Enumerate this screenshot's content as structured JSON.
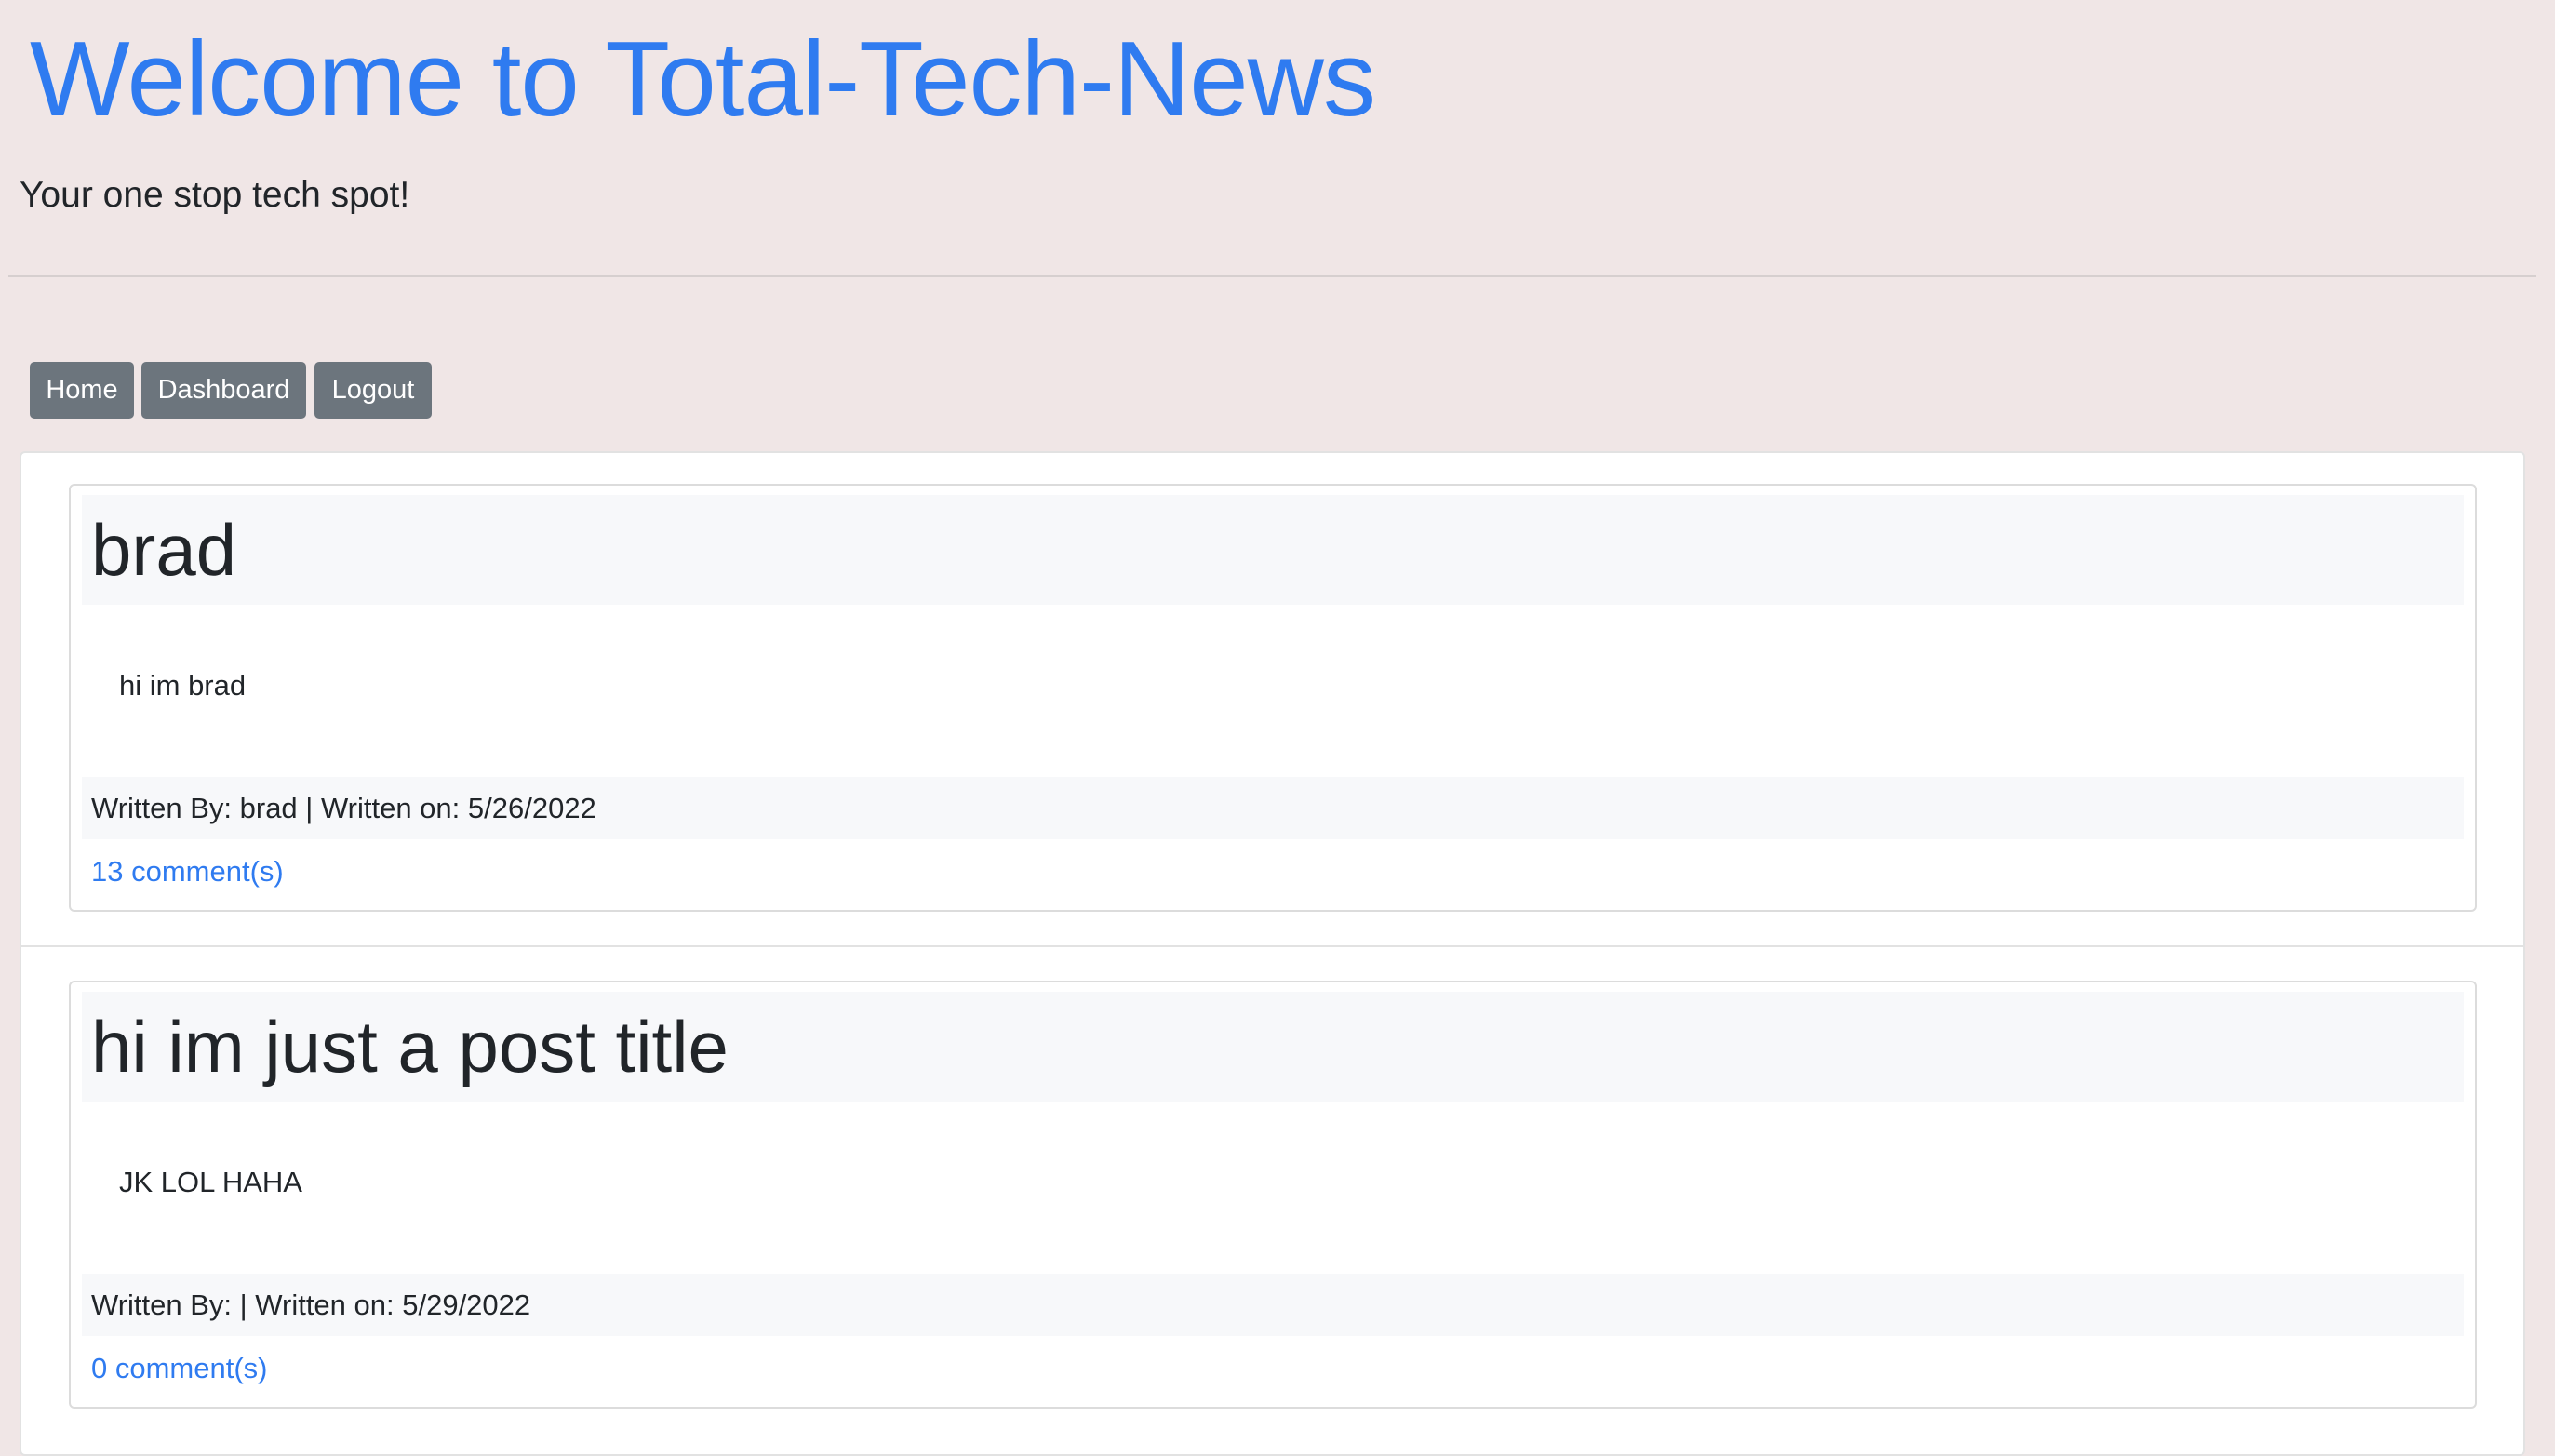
{
  "header": {
    "title": "Welcome to Total-Tech-News",
    "tagline": "Your one stop tech spot!"
  },
  "nav": {
    "home": "Home",
    "dashboard": "Dashboard",
    "logout": "Logout"
  },
  "posts": [
    {
      "title": "brad",
      "body": "hi im brad",
      "meta": "Written By: brad | Written on: 5/26/2022",
      "comments": "13 comment(s)"
    },
    {
      "title": "hi im just a post title",
      "body": "JK LOL HAHA",
      "meta": "Written By: | Written on: 5/29/2022",
      "comments": "0 comment(s)"
    }
  ]
}
